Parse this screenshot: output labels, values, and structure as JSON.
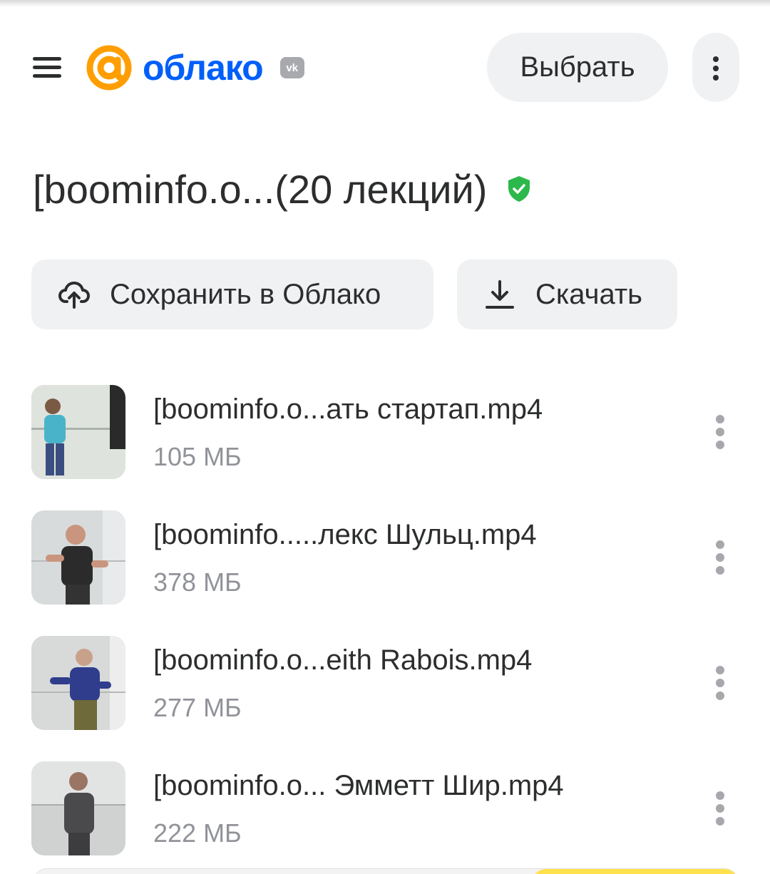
{
  "header": {
    "logo_text": "облако",
    "vk_badge": "vk",
    "select_label": "Выбрать"
  },
  "folder": {
    "title": "[boominfo.o...(20 лекций)"
  },
  "actions": {
    "save_label": "Сохранить в Облако",
    "download_label": "Скачать"
  },
  "files": [
    {
      "name": "[boominfo.o...ать стартап.mp4",
      "size": "105 МБ"
    },
    {
      "name": "[boominfo.....лекс Шульц.mp4",
      "size": "378 МБ"
    },
    {
      "name": "[boominfo.o...eith Rabois.mp4",
      "size": "277 МБ"
    },
    {
      "name": "[boominfo.o... Эмметт Шир.mp4",
      "size": "222 МБ"
    }
  ],
  "colors": {
    "brand_blue": "#005ff9",
    "brand_orange": "#ff9e00",
    "verified_green": "#2db84b",
    "button_bg": "#f0f1f3"
  },
  "icons": {
    "menu": "hamburger-icon",
    "more": "more-vertical-icon",
    "verified": "shield-check-icon",
    "save": "cloud-upload-icon",
    "download": "download-icon"
  }
}
